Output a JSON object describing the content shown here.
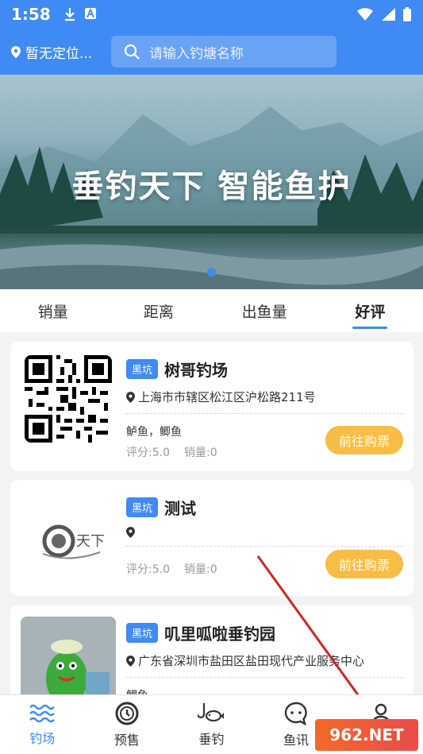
{
  "status": {
    "time": "1:58"
  },
  "header": {
    "location": "暂无定位...",
    "search_placeholder": "请输入钓塘名称"
  },
  "banner": {
    "caption": "垂钓天下  智能鱼护"
  },
  "tabs": [
    {
      "label": "销量",
      "active": false
    },
    {
      "label": "距离",
      "active": false
    },
    {
      "label": "出鱼量",
      "active": false
    },
    {
      "label": "好评",
      "active": true
    }
  ],
  "cards": [
    {
      "badge": "黑坑",
      "name": "树哥钓场",
      "address": "上海市市辖区松江区沪松路211号",
      "fish": "鲈鱼，鲫鱼",
      "score": "评分:5.0",
      "sales": "销量:0",
      "button": "前往购票"
    },
    {
      "badge": "黑坑",
      "name": "测试",
      "address": "",
      "fish": "",
      "score": "评分:5.0",
      "sales": "销量:0",
      "button": "前往购票"
    },
    {
      "badge": "黑坑",
      "name": "叽里呱啦垂钓园",
      "address": "广东省深圳市盐田区盐田现代产业服务中心",
      "fish": "鲤鱼",
      "score": "",
      "sales": "",
      "button": ""
    }
  ],
  "nav": [
    {
      "label": "钓场",
      "icon": "waves-icon",
      "active": true
    },
    {
      "label": "预售",
      "icon": "clock-icon",
      "active": false
    },
    {
      "label": "垂钓",
      "icon": "fish-hook-icon",
      "active": false
    },
    {
      "label": "鱼讯",
      "icon": "chat-icon",
      "active": false
    },
    {
      "label": "我的",
      "icon": "user-icon",
      "active": false
    }
  ],
  "watermark": "962.NET",
  "colors": {
    "primary": "#3f8af3",
    "buy_button": "#f7bd44"
  }
}
